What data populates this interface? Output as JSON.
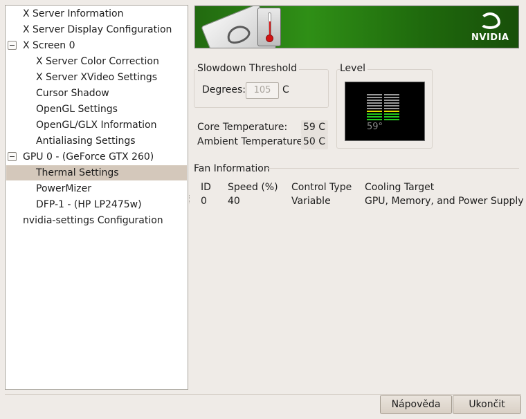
{
  "tree": {
    "items": [
      {
        "label": "X Server Information",
        "level": 1,
        "expander": false,
        "selected": false
      },
      {
        "label": "X Server Display Configuration",
        "level": 1,
        "expander": false,
        "selected": false
      },
      {
        "label": "X Screen 0",
        "level": 1,
        "expander": true,
        "selected": false
      },
      {
        "label": "X Server Color Correction",
        "level": 2,
        "expander": false,
        "selected": false
      },
      {
        "label": "X Server XVideo Settings",
        "level": 2,
        "expander": false,
        "selected": false
      },
      {
        "label": "Cursor Shadow",
        "level": 2,
        "expander": false,
        "selected": false
      },
      {
        "label": "OpenGL Settings",
        "level": 2,
        "expander": false,
        "selected": false
      },
      {
        "label": "OpenGL/GLX Information",
        "level": 2,
        "expander": false,
        "selected": false
      },
      {
        "label": "Antialiasing Settings",
        "level": 2,
        "expander": false,
        "selected": false
      },
      {
        "label": "GPU 0 - (GeForce GTX 260)",
        "level": 1,
        "expander": true,
        "selected": false
      },
      {
        "label": "Thermal Settings",
        "level": 2,
        "expander": false,
        "selected": true
      },
      {
        "label": "PowerMizer",
        "level": 2,
        "expander": false,
        "selected": false
      },
      {
        "label": "DFP-1 - (HP LP2475w)",
        "level": 2,
        "expander": false,
        "selected": false
      },
      {
        "label": "nvidia-settings Configuration",
        "level": 1,
        "expander": false,
        "selected": false
      }
    ]
  },
  "banner": {
    "logo_text": "NVIDIA",
    "brand_color": "#2f8f16",
    "chip_icon": "gpu-chip-icon",
    "thermometer_icon": "thermometer-icon"
  },
  "slowdown": {
    "title": "Slowdown Threshold",
    "degrees_label": "Degrees:",
    "degrees_value": "105",
    "unit": "C"
  },
  "level": {
    "title": "Level",
    "reading": "59°",
    "fraction": 0.59
  },
  "temps": {
    "core_label": "Core Temperature:",
    "core_value": "59 C",
    "ambient_label": "Ambient Temperature:",
    "ambient_value": "50 C"
  },
  "fan": {
    "title": "Fan Information",
    "headers": [
      "ID",
      "Speed (%)",
      "Control Type",
      "Cooling Target"
    ],
    "rows": [
      [
        "0",
        "40",
        "Variable",
        "GPU, Memory, and Power Supply"
      ]
    ]
  },
  "buttons": {
    "help": "Nápověda",
    "quit": "Ukončit"
  }
}
